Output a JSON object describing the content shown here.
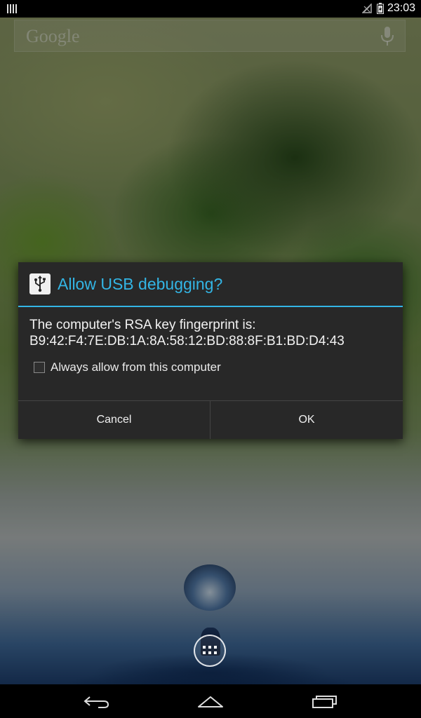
{
  "status_bar": {
    "time": "23:03",
    "icons": [
      "notification-icon",
      "no-signal-icon",
      "battery-charging-icon"
    ]
  },
  "home": {
    "search_bar": {
      "logo": "Google",
      "mic_icon": "microphone-icon"
    },
    "app_drawer_icon": "all-apps-icon"
  },
  "dialog": {
    "title_icon": "usb-icon",
    "title": "Allow USB debugging?",
    "message_line1": "The computer's RSA key fingerprint is:",
    "message_line2": "B9:42:F4:7E:DB:1A:8A:58:12:BD:88:8F:B1:BD:D4:43",
    "checkbox_label": "Always allow from this computer",
    "checkbox_checked": false,
    "cancel_label": "Cancel",
    "ok_label": "OK",
    "accent_color": "#33b5e5"
  },
  "nav_bar": {
    "icons": [
      "back-icon",
      "home-icon",
      "recents-icon"
    ]
  }
}
